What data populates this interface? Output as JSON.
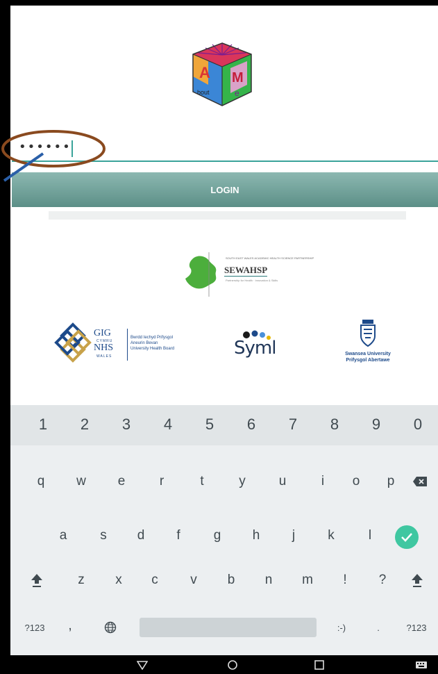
{
  "app": {
    "logo_letters": [
      "A",
      "M",
      "e",
      "bout"
    ]
  },
  "login": {
    "password_mask": "••••••",
    "button_label": "LOGIN"
  },
  "partners": {
    "sewahsp": {
      "small_text": "SOUTH EAST WALES ACADEMIC HEALTH SCIENCE PARTNERSHIP",
      "name": "SEWAHSP",
      "tagline": "Partnership for Health · Innovation & Skills"
    },
    "nhs": {
      "gig": "GIG",
      "cymru": "CYMRU",
      "nhs": "NHS",
      "wales": "WALES",
      "board_line1": "Bwrdd Iechyd Prifysgol",
      "board_line2": "Aneurin Bevan",
      "board_line3": "University Health Board"
    },
    "syml": {
      "name": "Syml"
    },
    "swansea": {
      "en": "Swansea University",
      "cy": "Prifysgol Abertawe"
    }
  },
  "keyboard": {
    "numbers": [
      "1",
      "2",
      "3",
      "4",
      "5",
      "6",
      "7",
      "8",
      "9",
      "0"
    ],
    "row1": [
      "q",
      "w",
      "e",
      "r",
      "t",
      "y",
      "u",
      "i",
      "o",
      "p"
    ],
    "row2": [
      "a",
      "s",
      "d",
      "f",
      "g",
      "h",
      "j",
      "k",
      "l"
    ],
    "row3": [
      "z",
      "x",
      "c",
      "v",
      "b",
      "n",
      "m",
      "!",
      "?"
    ],
    "symbols_key": "?123",
    "comma": ",",
    "emoticon": ":-)",
    "period": ".",
    "symbols_key_right": "?123"
  },
  "colors": {
    "accent": "#3aa39a",
    "login_button": "#6f9f98",
    "enter_key": "#3fc7a1",
    "annotation": "#8a4a1f"
  }
}
